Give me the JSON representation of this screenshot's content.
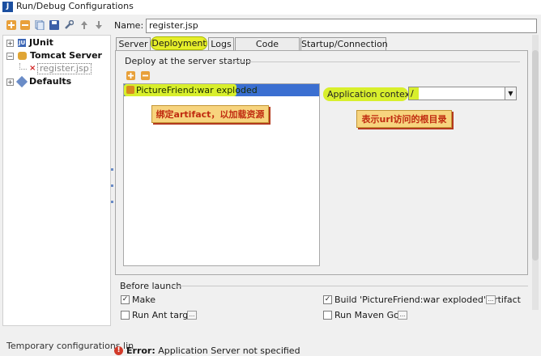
{
  "window": {
    "title": "Run/Debug Configurations"
  },
  "toolbar": {
    "icons": [
      "add-icon",
      "remove-icon",
      "copy-icon",
      "save-icon",
      "wrench-icon",
      "up-arrow-icon",
      "down-arrow-icon"
    ]
  },
  "tree": {
    "items": [
      {
        "label": "JUnit"
      },
      {
        "label": "Tomcat Server"
      },
      {
        "label": "register.jsp"
      },
      {
        "label": "Defaults"
      }
    ]
  },
  "name_field": {
    "label": "Name:",
    "value": "register.jsp"
  },
  "tabs": [
    "Server",
    "Deployment",
    "Logs",
    "Code Coverage",
    "Startup/Connection"
  ],
  "deployment": {
    "group_label": "Deploy at the server startup",
    "artifacts": [
      "PictureFriend:war exploded"
    ],
    "context_label": "Application context:",
    "context_value": "/",
    "annotation_artifact": "绑定artifact，以加载资源",
    "annotation_context": "表示url访问的根目录"
  },
  "before_launch": {
    "label": "Before launch",
    "make": "Make",
    "build_artifact": "Build 'PictureFriend:war exploded' artifact",
    "run_ant": "Run Ant target",
    "run_maven": "Run Maven Goal",
    "ellipsis": "..."
  },
  "footer": {
    "temp_label": "Temporary configurations lin",
    "error_bold": "Error:",
    "error_text": "Application Server not specified"
  },
  "colors": {
    "highlight": "#d8ef2c",
    "selection": "#3b6fd1",
    "callout_bg": "#f7d47e",
    "callout_text": "#c02b10"
  }
}
